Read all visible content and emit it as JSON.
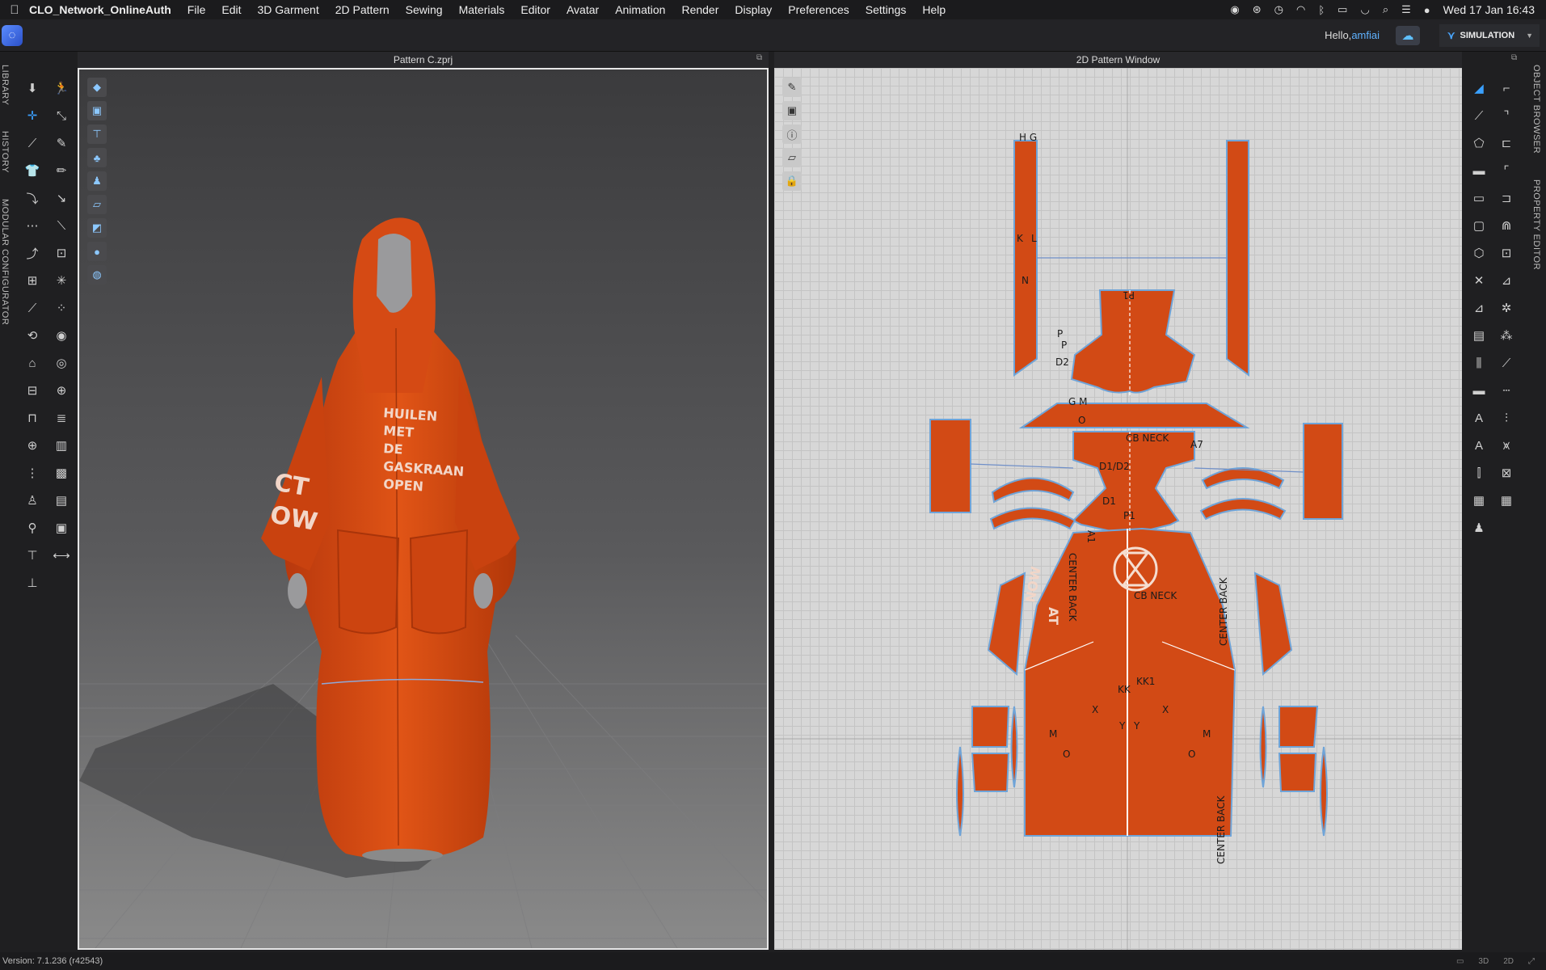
{
  "menubar": {
    "apple_icon": "apple-icon",
    "app_name": "CLO_Network_OnlineAuth",
    "items": [
      "File",
      "Edit",
      "3D Garment",
      "2D Pattern",
      "Sewing",
      "Materials",
      "Editor",
      "Avatar",
      "Animation",
      "Render",
      "Display",
      "Preferences",
      "Settings",
      "Help"
    ],
    "clock": "Wed 17 Jan  16:43"
  },
  "toolbar": {
    "hello_label": "Hello,",
    "username": "amfiai",
    "mode_label": "SIMULATION"
  },
  "left_tabs": [
    "LIBRARY",
    "HISTORY",
    "MODULAR CONFIGURATOR"
  ],
  "right_tabs": [
    "OBJECT BROWSER",
    "PROPERTY EDITOR"
  ],
  "view3d": {
    "title": "Pattern C.zprj",
    "garment_print": [
      "HUILEN",
      "MET",
      "DE",
      "GASKRAAN",
      "OPEN"
    ],
    "sleeve_print_left": "CT",
    "sleeve_print_left2": "OW"
  },
  "view2d": {
    "title": "2D Pattern Window",
    "labels": {
      "hg": "H G",
      "k": "K",
      "l": "L",
      "n": "N",
      "p1": "P1",
      "p": "P",
      "p2": "P",
      "d2": "D2",
      "gm": "G M",
      "o": "O",
      "cbneck": "CB NECK",
      "a7": "A7",
      "d1d2": "D1/D2",
      "d1": "D1",
      "p1b": "P1",
      "a1": "A1",
      "center_back_a": "CENTER BACK",
      "center_back_b": "CENTER BACK",
      "center_back_c": "CENTER BACK",
      "cb_neck2": "CB NECK",
      "print_a": "AT",
      "print_b": "NOW",
      "m1": "M",
      "m2": "M",
      "o1": "O",
      "o2": "O",
      "x1": "X",
      "x2": "X",
      "y1": "Y",
      "y2": "Y",
      "kk": "KK",
      "kk1": "KK1"
    }
  },
  "status": {
    "version": "Version: 7.1.236 (r42543)"
  },
  "colors": {
    "fabric": "#d24a15",
    "fabric_dark": "#b83a0c",
    "accent": "#3aa0ff",
    "seam_blue": "#6fa4d8"
  }
}
